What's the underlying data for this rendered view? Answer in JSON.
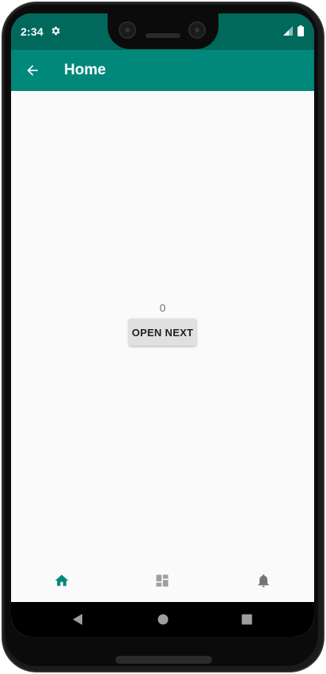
{
  "status_bar": {
    "time": "2:34",
    "background": "#00695c",
    "icons": [
      "gear-icon",
      "signal-icon",
      "battery-icon"
    ]
  },
  "app_bar": {
    "title": "Home",
    "background": "#00897b",
    "navigation_icon": "arrow-back-icon"
  },
  "content": {
    "counter": "0",
    "button_label": "OPEN NEXT"
  },
  "bottom_nav": {
    "items": [
      {
        "icon": "home-icon",
        "selected": true,
        "color": "#00897b"
      },
      {
        "icon": "dashboard-icon",
        "selected": false,
        "color": "#9e9e9e"
      },
      {
        "icon": "notifications-icon",
        "selected": false,
        "color": "#757575"
      }
    ]
  },
  "system_nav": {
    "buttons": [
      "back-triangle-icon",
      "home-circle-icon",
      "recents-square-icon"
    ]
  }
}
